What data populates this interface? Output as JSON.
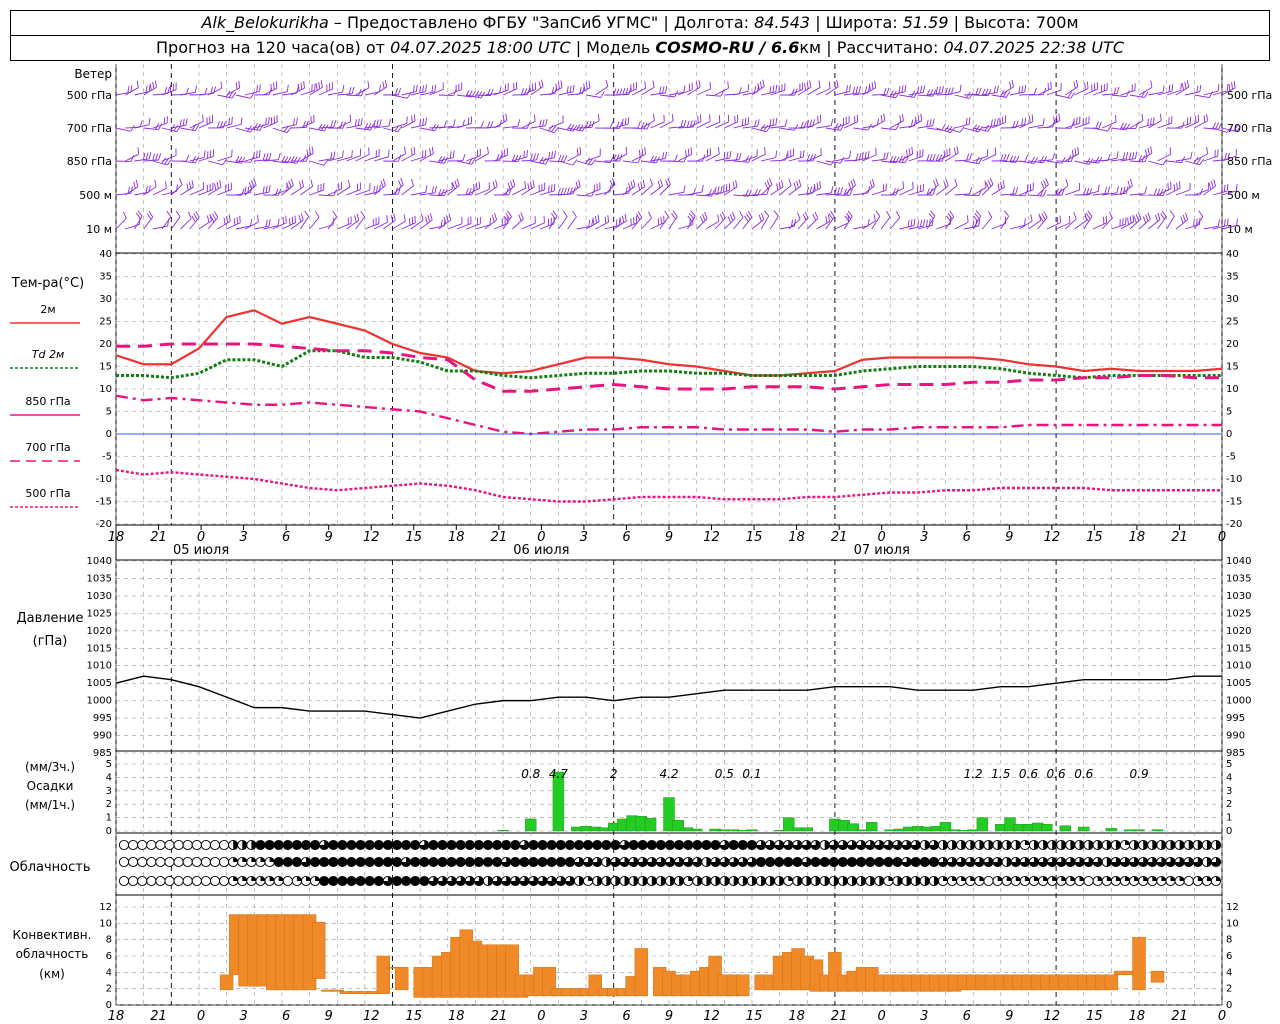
{
  "header": {
    "station": "Alk_Belokurikha",
    "dash": " – Предоставлено ФГБУ \"ЗапСиб УГМС\" | Долгота: ",
    "lon": "84.543",
    "lat_label": " | Широта: ",
    "lat": "51.59",
    "alt_label": " | Высота: ",
    "alt": "700м",
    "forecast_label": "Прогноз на 120 часа(ов) от ",
    "forecast_time": "04.07.2025 18:00 UTC",
    "model_label": " | Модель ",
    "model": "COSMO-RU / 6.6",
    "model_unit": "км",
    "calc_label": " | Рассчитано: ",
    "calc_time": "04.07.2025 22:38 UTC"
  },
  "colors": {
    "wind": "#8a2be2",
    "t2m": "#ee3333",
    "td2m": "#137d13",
    "t850": "#e8157f",
    "t700": "#e8157f",
    "t500": "#e8157f",
    "zero_line": "#3355ff",
    "precip": "#22cc22",
    "convective": "#f08a28",
    "pressure": "#000000",
    "grid": "#999999"
  },
  "time_axis": {
    "ticks": [
      "18",
      "21",
      "0",
      "3",
      "6",
      "9",
      "12",
      "15",
      "18",
      "21",
      "0",
      "3",
      "6",
      "9",
      "12",
      "15",
      "18",
      "21",
      "0",
      "3",
      "6",
      "9",
      "12",
      "15",
      "18",
      "21",
      "0"
    ],
    "dates": [
      "05 июля",
      "06 июля",
      "07 июля"
    ]
  },
  "wind_panel": {
    "title": "Ветер",
    "levels": [
      "500 гПа",
      "700 гПа",
      "850 гПа",
      "500 м",
      "10 м"
    ]
  },
  "temp_panel": {
    "title": "Тем-ра(°C)",
    "legend": [
      "2м",
      "Td 2м",
      "850 гПа",
      "700 гПа",
      "500 гПа"
    ],
    "y_ticks": [
      "40",
      "35",
      "30",
      "25",
      "20",
      "15",
      "10",
      "5",
      "0",
      "-5",
      "-10",
      "-15",
      "-20"
    ]
  },
  "pressure_panel": {
    "title_1": "Давление",
    "title_2": "(гПа)",
    "y_ticks": [
      "1040",
      "1035",
      "1030",
      "1025",
      "1020",
      "1015",
      "1010",
      "1005",
      "1000",
      "995",
      "990",
      "985"
    ]
  },
  "precip_panel": {
    "title_1": "(мм/3ч.)",
    "title_2": "Осадки",
    "title_3": "(мм/1ч.)",
    "y_ticks": [
      "5",
      "4",
      "3",
      "2",
      "1",
      "0"
    ],
    "totals": [
      "0.8",
      "4.7",
      "2",
      "4.2",
      "0.5",
      "0.1",
      "1.2",
      "1.5",
      "0.6",
      "0.6",
      "0.6",
      "0.9"
    ]
  },
  "cloud_panel": {
    "title": "Облачность"
  },
  "conv_panel": {
    "title_1": "Конвективн.",
    "title_2": "облачность",
    "title_3": "(км)",
    "y_ticks": [
      "12",
      "10",
      "8",
      "6",
      "4",
      "2",
      "0"
    ]
  },
  "chart_data": {
    "type": "line",
    "x_unit": "hours since 04.07.2025 18:00 UTC",
    "x": [
      0,
      3,
      6,
      9,
      12,
      15,
      18,
      21,
      24,
      27,
      30,
      33,
      36,
      39,
      42,
      45,
      48,
      51,
      54,
      57,
      60,
      63,
      66,
      69,
      72,
      75,
      78,
      81,
      84,
      87,
      90,
      93,
      96,
      99,
      102,
      105,
      108,
      111,
      114,
      117,
      120
    ],
    "series": [
      {
        "name": "2м",
        "values": [
          17.5,
          15.5,
          15.5,
          19,
          26,
          27.5,
          24.5,
          26,
          24.5,
          23,
          20,
          18,
          17,
          14,
          13.5,
          14,
          15.5,
          17,
          17,
          16.5,
          15.5,
          15,
          14,
          13,
          13,
          13.5,
          14,
          16.5,
          17,
          17,
          17,
          17,
          16.5,
          15.5,
          15,
          14,
          14.5,
          14,
          14,
          14,
          14.5
        ]
      },
      {
        "name": "Td 2м",
        "values": [
          13,
          13,
          12.5,
          13.5,
          16.5,
          16.5,
          15,
          18.5,
          18.5,
          17,
          17,
          16,
          14,
          14,
          13,
          12.5,
          13,
          13.5,
          13.5,
          14,
          14,
          13.5,
          13.5,
          13,
          13,
          13,
          13,
          14,
          14.5,
          15,
          15,
          15,
          14.5,
          13.5,
          13,
          12.5,
          13,
          13,
          13,
          13,
          13
        ]
      },
      {
        "name": "850 гПа",
        "values": [
          19.5,
          19.5,
          20,
          20,
          20,
          20,
          19.5,
          19,
          18.5,
          18.5,
          18,
          17,
          16.5,
          12,
          9.5,
          9.5,
          10,
          10.5,
          11,
          10.5,
          10,
          10,
          10,
          10.5,
          10.5,
          10.5,
          10,
          10.5,
          11,
          11,
          11,
          11.5,
          11.5,
          12,
          12,
          12.5,
          12.5,
          13,
          13,
          12.5,
          12.5
        ]
      },
      {
        "name": "700 гПа",
        "values": [
          8.5,
          7.5,
          8,
          7.5,
          7,
          6.5,
          6.5,
          7,
          6.5,
          6,
          5.5,
          5,
          3.5,
          2,
          0.5,
          0,
          0.5,
          1,
          1,
          1.5,
          1.5,
          1.5,
          1,
          1,
          1,
          1,
          0.5,
          1,
          1,
          1.5,
          1.5,
          1.5,
          1.5,
          2,
          2,
          2,
          2,
          2,
          2,
          2,
          2
        ]
      },
      {
        "name": "500 гПа",
        "values": [
          -8,
          -9,
          -8.5,
          -9,
          -9.5,
          -10,
          -11,
          -12,
          -12.5,
          -12,
          -11.5,
          -11,
          -11.5,
          -12.5,
          -14,
          -14.5,
          -15,
          -15,
          -14.5,
          -14,
          -14,
          -14,
          -14.5,
          -14.5,
          -14.5,
          -14,
          -14,
          -13.5,
          -13,
          -13,
          -12.5,
          -12.5,
          -12,
          -12,
          -12,
          -12,
          -12.5,
          -12.5,
          -12.5,
          -12.5,
          -12.5
        ]
      },
      {
        "name": "Давление",
        "values": [
          1005,
          1007,
          1006,
          1004,
          1001,
          998,
          998,
          997,
          997,
          997,
          996,
          995,
          997,
          999,
          1000,
          1000,
          1001,
          1001,
          1000,
          1001,
          1001,
          1002,
          1003,
          1003,
          1003,
          1003,
          1004,
          1004,
          1004,
          1003,
          1003,
          1003,
          1004,
          1004,
          1005,
          1006,
          1006,
          1006,
          1006,
          1007,
          1007
        ]
      }
    ],
    "ylim_temp": [
      -20,
      40
    ],
    "ylim_pressure": [
      985,
      1040
    ],
    "precip_hourly_mm": {
      "x": [
        42,
        45,
        48,
        50,
        51,
        52,
        53,
        54,
        55,
        56,
        57,
        58,
        60,
        61,
        62,
        63,
        65,
        66,
        67,
        68,
        69,
        72,
        73,
        74,
        75,
        78,
        79,
        80,
        81,
        82,
        84,
        85,
        86,
        87,
        88,
        89,
        90,
        91,
        92,
        93,
        94,
        96,
        97,
        98,
        99,
        100,
        101,
        103,
        105,
        108,
        110,
        111,
        113
      ],
      "values": [
        0.05,
        0.9,
        4.4,
        0.3,
        0.35,
        0.3,
        0.25,
        0.6,
        0.9,
        1.15,
        1.1,
        0.95,
        2.5,
        0.8,
        0.25,
        0.15,
        0.15,
        0.1,
        0.1,
        0.05,
        0.1,
        0.05,
        1,
        0.25,
        0.25,
        0.9,
        0.8,
        0.55,
        0.1,
        0.65,
        0.1,
        0.15,
        0.3,
        0.35,
        0.3,
        0.35,
        0.65,
        0.1,
        0.05,
        0.1,
        1,
        0.5,
        1,
        0.5,
        0.5,
        0.6,
        0.5,
        0.4,
        0.3,
        0.2,
        0.1,
        0.1,
        0.1
      ],
      "ylim": [
        0,
        5
      ]
    },
    "precip_3h_totals": {
      "x": [
        45,
        48,
        51,
        54,
        57,
        60,
        66,
        69,
        72,
        75,
        78,
        81,
        84,
        87,
        90,
        93,
        96,
        99,
        102,
        105,
        108,
        111,
        114
      ],
      "values": [
        "0.8",
        "4.7",
        "",
        "2",
        "",
        "4.2",
        "0.5",
        "0.1",
        "",
        "",
        "",
        "",
        "",
        "",
        "",
        "1.2",
        "1.5",
        "0.6",
        "0.6",
        "0.6",
        "",
        "0.9",
        ""
      ]
    },
    "convective_km": {
      "x": [
        12,
        13,
        14,
        15,
        16,
        17,
        18,
        19,
        20,
        21,
        22,
        23,
        24,
        25,
        26,
        27,
        28,
        29,
        30,
        31,
        33,
        34,
        35,
        36,
        37,
        38,
        39,
        40,
        41,
        42,
        43,
        44,
        45,
        46,
        47,
        48,
        49,
        50,
        51,
        52,
        53,
        54,
        55,
        56,
        57,
        59,
        60,
        61,
        62,
        63,
        64,
        65,
        66,
        67,
        68,
        70,
        71,
        72,
        73,
        74,
        75,
        76,
        77,
        78,
        79,
        80,
        81,
        82,
        83,
        84,
        85,
        86,
        87,
        88,
        89,
        90,
        91,
        92,
        93,
        94,
        95,
        96,
        97,
        98,
        99,
        100,
        101,
        102,
        103,
        104,
        105,
        106,
        107,
        108,
        109,
        110,
        111,
        113,
        115,
        116
      ],
      "base": [
        2,
        4,
        2.5,
        2.5,
        2.5,
        2,
        2,
        2,
        2,
        2,
        3.5,
        1.8,
        1.8,
        1.5,
        1.5,
        1.5,
        1.5,
        1.5,
        5,
        2,
        1,
        1,
        1,
        1,
        1,
        1,
        1,
        1,
        1,
        1,
        1,
        1,
        1.2,
        1.2,
        1.2,
        1.2,
        1.2,
        1.2,
        1.2,
        1.2,
        1.2,
        1.2,
        1.2,
        1.2,
        1.2,
        1.2,
        1.2,
        1.2,
        1.2,
        1.2,
        1.2,
        1.2,
        1.2,
        1.2,
        1.2,
        2,
        2,
        2,
        2,
        2,
        2,
        1.8,
        1.8,
        1.8,
        1.8,
        1.8,
        1.8,
        1.8,
        1.8,
        1.8,
        1.8,
        1.8,
        1.8,
        1.8,
        1.8,
        1.8,
        1.8,
        2,
        2,
        2,
        2,
        2,
        2,
        2,
        2,
        2,
        2,
        2,
        2,
        2,
        2,
        2,
        2,
        2,
        4,
        4,
        2,
        3
      ],
      "top": [
        4,
        12,
        12,
        12,
        12,
        12,
        12,
        12,
        12,
        12,
        11,
        2,
        2,
        1.8,
        1.8,
        1.8,
        1.8,
        6.5,
        5,
        5,
        5,
        5,
        6.5,
        7,
        9,
        10,
        8.5,
        8,
        8,
        8,
        8,
        4,
        4,
        5,
        5,
        2.2,
        2.2,
        2.2,
        2.2,
        4,
        2.2,
        2.2,
        2.2,
        3.8,
        7.5,
        5,
        4.5,
        4,
        4,
        4.5,
        5,
        6.5,
        4,
        4,
        4,
        4,
        4,
        6.5,
        7,
        7.5,
        6.5,
        6,
        4,
        7,
        4,
        4.5,
        5,
        5,
        4,
        4,
        4,
        4,
        4,
        4,
        4,
        4,
        4,
        4,
        4,
        4,
        4,
        4,
        4,
        4,
        4,
        4,
        4,
        4,
        4,
        4,
        4,
        4,
        4,
        4,
        4.5,
        4.5,
        9,
        4.5,
        3.5,
        3.5
      ],
      "ylim": [
        0,
        13
      ]
    }
  }
}
